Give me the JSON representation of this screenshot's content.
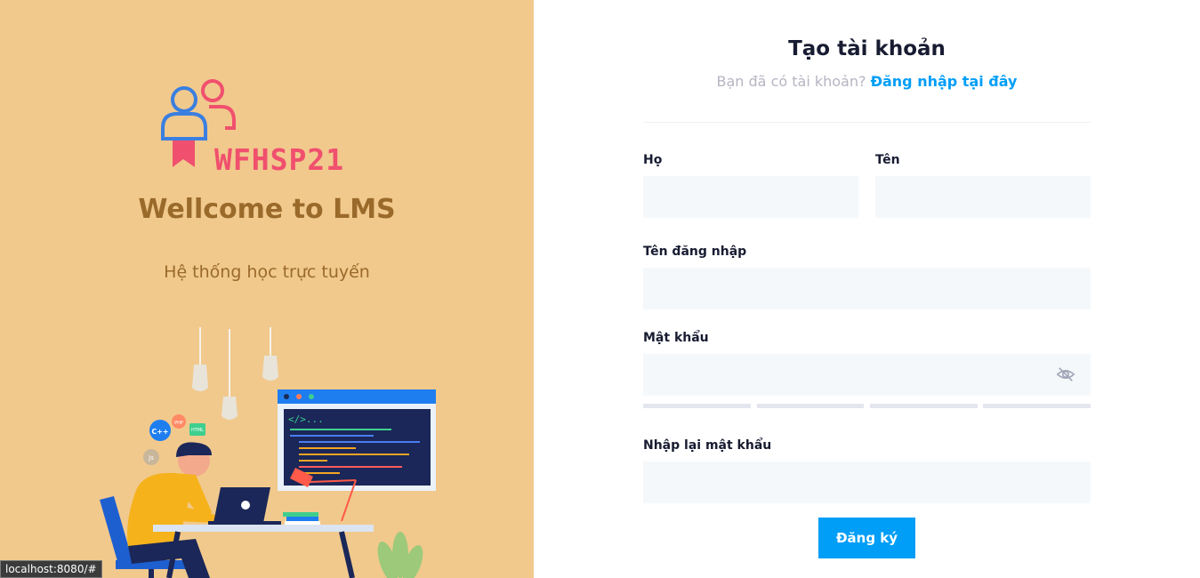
{
  "left": {
    "logo_text": "WFHSP21",
    "welcome": "Wellcome to LMS",
    "subtitle": "Hệ thống học trực tuyến",
    "code_badges": [
      "C++",
      "PHP",
      "HTML",
      "Js"
    ],
    "code_prompt": "</>..."
  },
  "form": {
    "title": "Tạo tài khoản",
    "has_account_text": "Bạn đã có tài khoản?",
    "login_link": "Đăng nhập tại đây",
    "first_name_label": "Họ",
    "last_name_label": "Tên",
    "username_label": "Tên đăng nhập",
    "password_label": "Mật khẩu",
    "confirm_password_label": "Nhập lại mật khẩu",
    "submit_label": "Đăng ký"
  },
  "status_bar": {
    "url": "localhost:8080/#"
  },
  "colors": {
    "left_bg": "#f1c98d",
    "accent": "#009ef7",
    "brand": "#f0506e",
    "welcome_text": "#9a6a2a",
    "input_bg": "#f5f8fa"
  },
  "icons": [
    "users-logo-icon",
    "eye-slash-icon"
  ]
}
